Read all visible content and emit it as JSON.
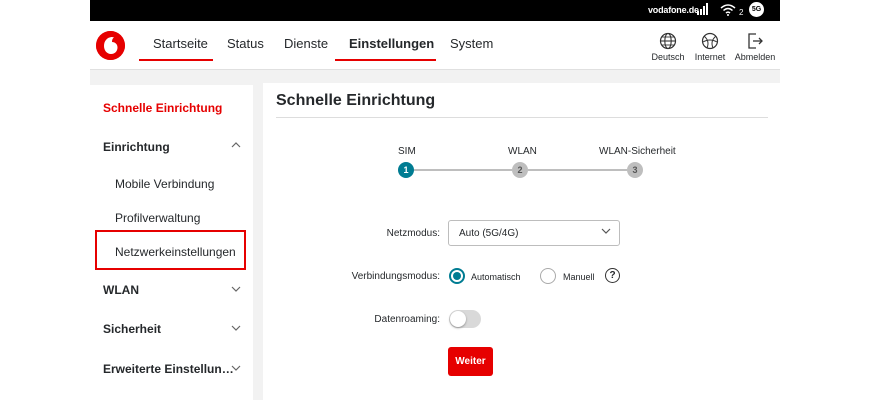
{
  "status_bar": {
    "operator": "vodafone.de",
    "wifi_count": "2",
    "network_badge": "5G"
  },
  "header": {
    "logo_glyph": "’",
    "nav": [
      {
        "label": "Startseite",
        "active": true
      },
      {
        "label": "Status",
        "active": false
      },
      {
        "label": "Dienste",
        "active": false
      },
      {
        "label": "Einstellungen",
        "active": true
      },
      {
        "label": "System",
        "active": false
      }
    ],
    "actions": [
      {
        "label": "Deutsch",
        "icon": "globe-icon"
      },
      {
        "label": "Internet",
        "icon": "internet-icon"
      },
      {
        "label": "Abmelden",
        "icon": "logout-icon"
      }
    ]
  },
  "sidebar": {
    "quick_setup": "Schnelle Einrichtung",
    "sections": [
      {
        "label": "Einrichtung",
        "expanded": true,
        "items": [
          "Mobile Verbindung",
          "Profilverwaltung",
          "Netzwerkeinstellungen"
        ]
      },
      {
        "label": "WLAN",
        "expanded": false
      },
      {
        "label": "Sicherheit",
        "expanded": false
      },
      {
        "label": "Erweiterte Einstellun…",
        "expanded": false
      }
    ],
    "highlighted_item": "Netzwerkeinstellungen"
  },
  "main": {
    "title": "Schnelle Einrichtung",
    "steps": [
      {
        "label": "SIM",
        "number": "1",
        "active": true
      },
      {
        "label": "WLAN",
        "number": "2",
        "active": false
      },
      {
        "label": "WLAN-Sicherheit",
        "number": "3",
        "active": false
      }
    ],
    "form": {
      "network_mode_label": "Netzmodus:",
      "network_mode_value": "Auto (5G/4G)",
      "connection_mode_label": "Verbindungsmodus:",
      "connection_mode_options": [
        {
          "label": "Automatisch",
          "selected": true
        },
        {
          "label": "Manuell",
          "selected": false
        }
      ],
      "help_glyph": "?",
      "roaming_label": "Datenroaming:",
      "roaming_enabled": false,
      "submit_label": "Weiter"
    }
  },
  "colors": {
    "brand_red": "#e60000",
    "accent_teal": "#007c92",
    "inactive_gray": "#bebebe"
  }
}
